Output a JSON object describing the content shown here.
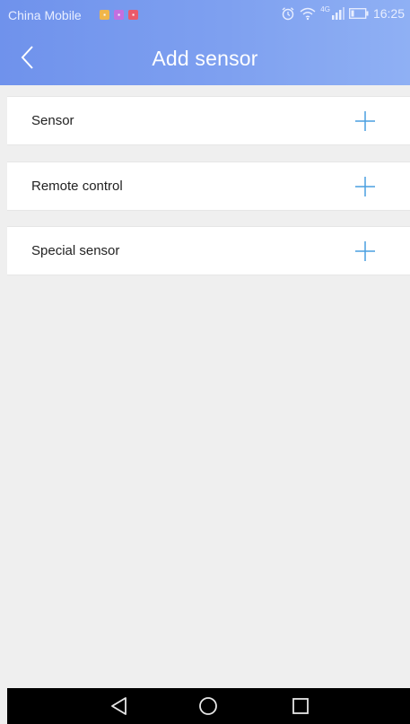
{
  "status_bar": {
    "carrier": "China Mobile",
    "time": "16:25",
    "network": "4G"
  },
  "header": {
    "title": "Add sensor"
  },
  "list": {
    "items": [
      {
        "label": "Sensor"
      },
      {
        "label": "Remote control"
      },
      {
        "label": "Special sensor"
      }
    ]
  },
  "colors": {
    "header_start": "#6f92ec",
    "header_end": "#8fb0f4",
    "accent_plus": "#4a9fe0",
    "background": "#efefef",
    "row_bg": "#ffffff",
    "nav_bar": "#000000"
  },
  "icons": {
    "back": "chevron-left-icon",
    "add": "plus-icon",
    "nav_back": "triangle-back-icon",
    "nav_home": "circle-home-icon",
    "nav_recent": "square-recent-icon"
  }
}
